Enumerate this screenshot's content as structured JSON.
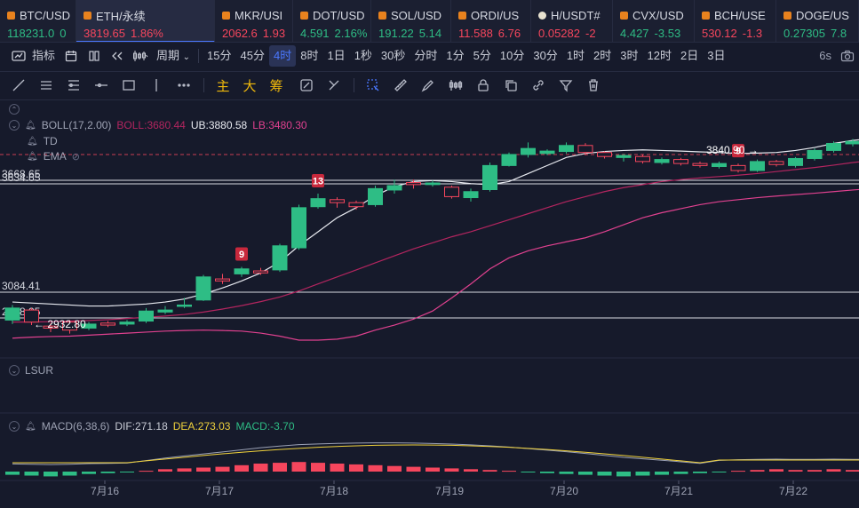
{
  "tickers": [
    {
      "name": "BTC/USD",
      "price": "118231.0",
      "change": "0",
      "dir": "up",
      "w": 86
    },
    {
      "name": "ETH/永续",
      "price": "3819.65",
      "change": "1.86%",
      "dir": "down",
      "w": 156,
      "active": true
    },
    {
      "name": "MKR/USI",
      "price": "2062.6",
      "change": "1.93",
      "dir": "down",
      "w": 88
    },
    {
      "name": "DOT/USD",
      "price": "4.591",
      "change": "2.16%",
      "dir": "up",
      "w": 88
    },
    {
      "name": "SOL/USD",
      "price": "191.22",
      "change": "5.14",
      "dir": "up",
      "w": 90
    },
    {
      "name": "ORDI/US",
      "price": "11.588",
      "change": "6.76",
      "dir": "down",
      "w": 90
    },
    {
      "name": "H/USDT#",
      "price": "0.05282",
      "change": "-2",
      "dir": "down",
      "w": 92,
      "dot": "white"
    },
    {
      "name": "CVX/USD",
      "price": "4.427",
      "change": "-3.53",
      "dir": "up",
      "w": 92
    },
    {
      "name": "BCH/USE",
      "price": "530.12",
      "change": "-1.3",
      "dir": "down",
      "w": 92
    },
    {
      "name": "DOGE/US",
      "price": "0.27305",
      "change": "7.8",
      "dir": "up",
      "w": 93
    }
  ],
  "periods": {
    "indicator": "指标",
    "cycle": "周期",
    "items": [
      "15分",
      "45分",
      "4时",
      "8时",
      "1日",
      "1秒",
      "30秒",
      "分时",
      "1分",
      "5分",
      "10分",
      "30分",
      "1时",
      "2时",
      "3时",
      "12时",
      "2日",
      "3日"
    ],
    "active": "4时",
    "timer": "6s"
  },
  "draw_tools": {
    "zhu": "主",
    "da": "大",
    "chou": "筹"
  },
  "indicators": {
    "boll": {
      "label": "BOLL(17,2.00)",
      "boll": "BOLL:3680.44",
      "ub": "UB:3880.58",
      "lb": "LB:3480.30"
    },
    "td": "TD",
    "ema": "EMA",
    "lsur": "LSUR",
    "macd": {
      "label": "MACD(6,38,6)",
      "dif": "DIF:271.18",
      "dea": "DEA:273.03",
      "macd": "MACD:-3.70"
    }
  },
  "colors": {
    "up": "#2ebd85",
    "down": "#f6465d",
    "mid": "#b3255f",
    "lower": "#e0418f",
    "upper": "#e8eaf0",
    "dea": "#f0d23c",
    "dif": "#9aa0b4"
  },
  "chart_data": {
    "type": "candlestick",
    "x_labels": [
      "7月16",
      "7月17",
      "7月18",
      "7月19",
      "7月20",
      "7月21",
      "7月22"
    ],
    "price_labels": [
      "3668.65",
      "3634.65",
      "3084.41",
      "2968.25"
    ],
    "annotations": {
      "high": "3840.90",
      "low": "2932.80",
      "td_marks": [
        "9",
        "13",
        "9"
      ]
    },
    "candles": [
      [
        3000,
        3060,
        2980,
        3075
      ],
      [
        3050,
        2990,
        2975,
        3060
      ],
      [
        2970,
        2960,
        2940,
        2985
      ],
      [
        2990,
        2950,
        2932.8,
        3000
      ],
      [
        2960,
        2980,
        2950,
        2990
      ],
      [
        2985,
        2975,
        2965,
        2995
      ],
      [
        2980,
        2990,
        2970,
        3000
      ],
      [
        2995,
        3045,
        2985,
        3060
      ],
      [
        3040,
        3050,
        3030,
        3070
      ],
      [
        3070,
        3075,
        3060,
        3110
      ],
      [
        3100,
        3215,
        3095,
        3225
      ],
      [
        3205,
        3195,
        3180,
        3230
      ],
      [
        3230,
        3255,
        3215,
        3265
      ],
      [
        3245,
        3235,
        3225,
        3260
      ],
      [
        3250,
        3370,
        3240,
        3380
      ],
      [
        3360,
        3560,
        3350,
        3575
      ],
      [
        3565,
        3605,
        3555,
        3630
      ],
      [
        3600,
        3585,
        3560,
        3612
      ],
      [
        3585,
        3565,
        3550,
        3595
      ],
      [
        3575,
        3655,
        3565,
        3670
      ],
      [
        3648,
        3670,
        3630,
        3700
      ],
      [
        3685,
        3675,
        3655,
        3700
      ],
      [
        3675,
        3683,
        3665,
        3696
      ],
      [
        3662,
        3615,
        3605,
        3670
      ],
      [
        3610,
        3640,
        3590,
        3655
      ],
      [
        3650,
        3770,
        3640,
        3785
      ],
      [
        3770,
        3825,
        3765,
        3835
      ],
      [
        3825,
        3855,
        3810,
        3885
      ],
      [
        3830,
        3842,
        3822,
        3851
      ],
      [
        3840,
        3870,
        3830,
        3885
      ],
      [
        3870,
        3835,
        3822,
        3882
      ],
      [
        3835,
        3815,
        3805,
        3840
      ],
      [
        3810,
        3820,
        3790,
        3828
      ],
      [
        3815,
        3790,
        3780,
        3825
      ],
      [
        3785,
        3800,
        3775,
        3810
      ],
      [
        3800,
        3780,
        3770,
        3808
      ],
      [
        3780,
        3770,
        3760,
        3790
      ],
      [
        3765,
        3780,
        3755,
        3790
      ],
      [
        3770,
        3745,
        3735,
        3780
      ],
      [
        3745,
        3790,
        3738,
        3800
      ],
      [
        3790,
        3775,
        3765,
        3798
      ],
      [
        3770,
        3805,
        3760,
        3812
      ],
      [
        3805,
        3845,
        3795,
        3855
      ],
      [
        3845,
        3880,
        3835,
        3890
      ],
      [
        3878,
        3890,
        3865,
        3902
      ],
      [
        3888,
        3895,
        3870,
        3905
      ],
      [
        3900,
        3880,
        3860,
        3912
      ],
      [
        3880,
        3885,
        3850,
        3895
      ],
      [
        3885,
        3890,
        3860,
        3900
      ],
      [
        3890,
        3905,
        3875,
        3912
      ],
      [
        3905,
        3910,
        3880,
        3925
      ],
      [
        3905,
        3900,
        3895,
        3912
      ]
    ],
    "boll_upper": [
      3090,
      3085,
      3080,
      3075,
      3070,
      3070,
      3075,
      3080,
      3090,
      3105,
      3130,
      3160,
      3195,
      3235,
      3290,
      3370,
      3440,
      3510,
      3560,
      3620,
      3665,
      3690,
      3695,
      3690,
      3680,
      3675,
      3690,
      3730,
      3770,
      3810,
      3830,
      3840,
      3845,
      3848,
      3845,
      3842,
      3838,
      3835,
      3830,
      3832,
      3835,
      3845,
      3860,
      3880,
      3895,
      3905,
      3912,
      3920,
      3928,
      3935,
      3945,
      3955
    ],
    "boll_mid": [
      2990,
      2990,
      2992,
      2995,
      2998,
      3002,
      3008,
      3014,
      3020,
      3028,
      3040,
      3055,
      3072,
      3092,
      3115,
      3145,
      3180,
      3215,
      3250,
      3285,
      3320,
      3355,
      3385,
      3415,
      3440,
      3470,
      3500,
      3530,
      3560,
      3590,
      3615,
      3640,
      3660,
      3675,
      3690,
      3700,
      3708,
      3715,
      3722,
      3730,
      3740,
      3750,
      3760,
      3772,
      3785,
      3795,
      3805,
      3815,
      3822,
      3830,
      3838,
      3845
    ],
    "boll_lower": [
      2910,
      2915,
      2918,
      2920,
      2925,
      2930,
      2935,
      2940,
      2945,
      2948,
      2950,
      2948,
      2945,
      2935,
      2920,
      2900,
      2900,
      2905,
      2920,
      2950,
      2975,
      3005,
      3045,
      3110,
      3180,
      3255,
      3310,
      3345,
      3370,
      3390,
      3410,
      3440,
      3475,
      3510,
      3535,
      3555,
      3575,
      3590,
      3600,
      3610,
      3618,
      3625,
      3632,
      3640,
      3648,
      3655,
      3660,
      3662,
      3660,
      3660,
      3665,
      3675
    ],
    "macd_hist": [
      -4,
      -5,
      -6,
      -5,
      -3,
      -2,
      -1,
      1,
      3,
      4,
      5,
      6,
      8,
      10,
      11,
      12,
      11,
      10,
      9,
      8,
      7,
      6,
      5,
      4,
      3,
      2,
      1,
      -1,
      -2,
      -3,
      -4,
      -5,
      -6,
      -5,
      -4,
      -3,
      -2,
      -1,
      1,
      2,
      3,
      2,
      2,
      3,
      2,
      2,
      1,
      -1,
      -2,
      -2,
      -2,
      -3
    ]
  }
}
